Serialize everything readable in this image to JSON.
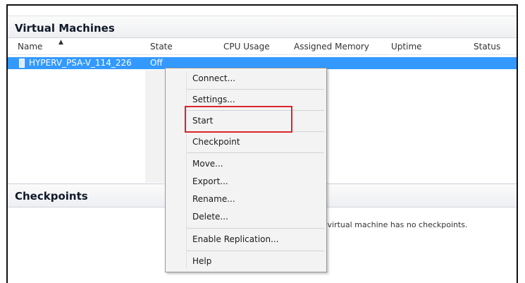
{
  "virtual_machines": {
    "title": "Virtual Machines",
    "columns": [
      "Name",
      "State",
      "CPU Usage",
      "Assigned Memory",
      "Uptime",
      "Status"
    ],
    "rows": [
      {
        "name": "HYPERV_PSA-V_114_226",
        "state": "Off"
      }
    ]
  },
  "checkpoints": {
    "title": "Checkpoints",
    "message": "d virtual machine has no checkpoints."
  },
  "context_menu": {
    "items": [
      "Connect...",
      "Settings...",
      "Start",
      "Checkpoint",
      "Move...",
      "Export...",
      "Rename...",
      "Delete...",
      "Enable Replication...",
      "Help"
    ]
  },
  "colors": {
    "selection": "#3399ff",
    "highlight_box": "#d9252b"
  },
  "icons": {
    "vm_row": "virtual-machine-icon",
    "sort": "sort-ascending-icon"
  }
}
